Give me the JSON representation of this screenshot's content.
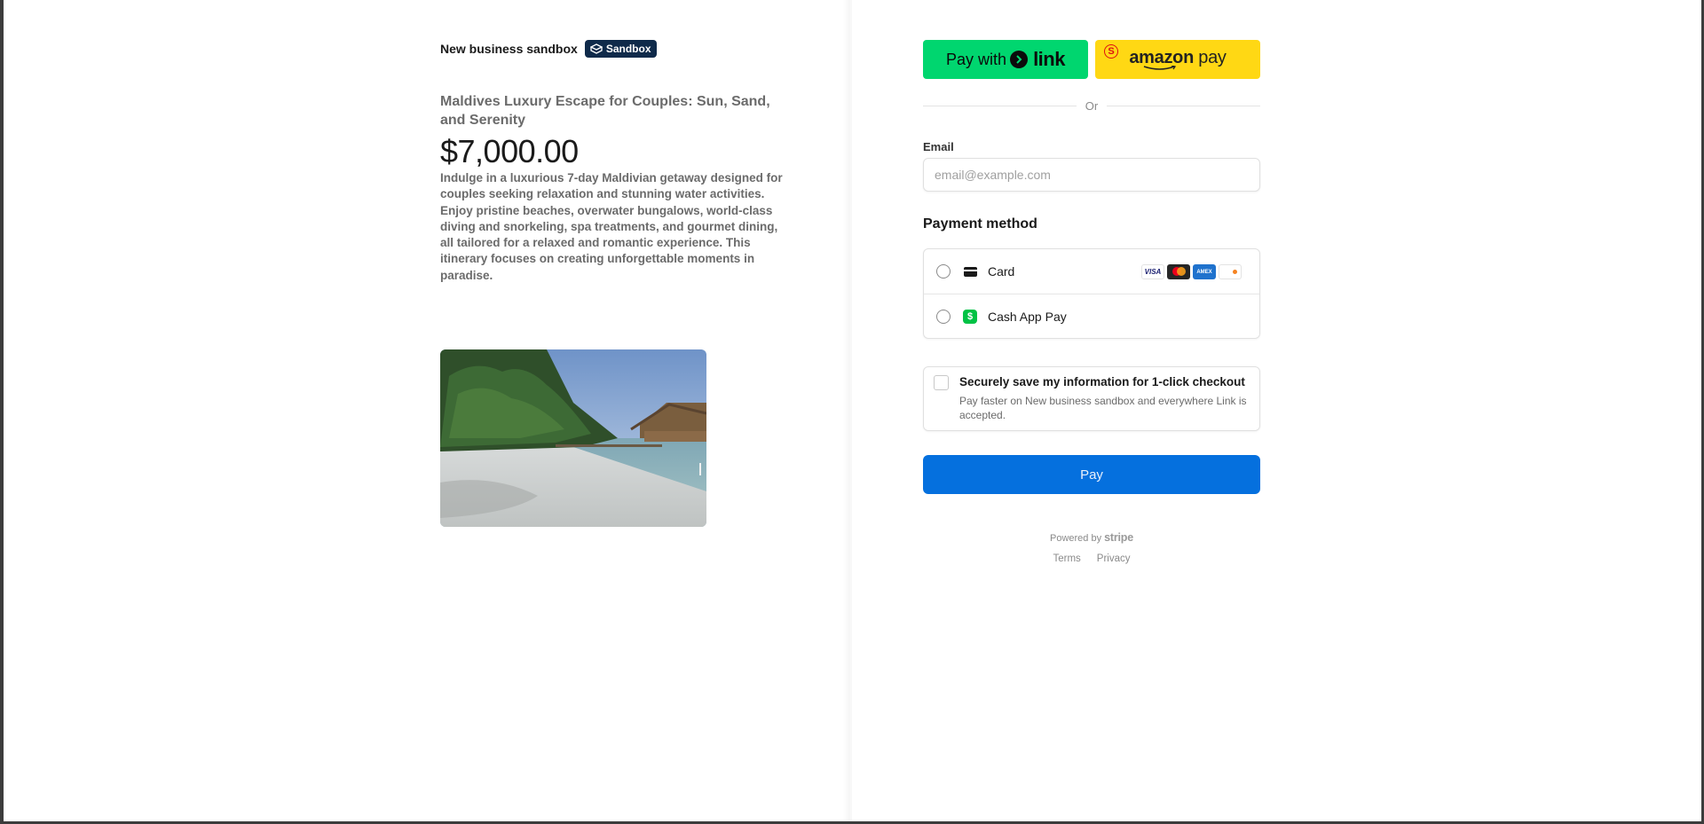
{
  "merchant": {
    "name": "New business sandbox",
    "badge": "Sandbox"
  },
  "product": {
    "title": "Maldives Luxury Escape for Couples: Sun, Sand, and Serenity",
    "price": "$7,000.00",
    "description": "Indulge in a luxurious 7-day Maldivian getaway designed for couples seeking relaxation and stunning water activities. Enjoy pristine beaches, overwater bungalows, world-class diving and snorkeling, spa treatments, and gourmet dining, all tailored for a relaxed and romantic experience. This itinerary focuses on creating unforgettable moments in paradise."
  },
  "wallets": {
    "link": {
      "prefix": "Pay with",
      "word": "link",
      "color": "#00d66f"
    },
    "amazon": {
      "brand": "amazon",
      "pay": "pay",
      "color": "#ffd814"
    }
  },
  "divider": "Or",
  "email": {
    "label": "Email",
    "placeholder": "email@example.com",
    "value": ""
  },
  "payment_method": {
    "title": "Payment method",
    "options": [
      {
        "label": "Card",
        "icon": "card-icon",
        "brands": [
          "VISA",
          "mastercard",
          "AMEX",
          "DISCOVER"
        ]
      },
      {
        "label": "Cash App Pay",
        "icon": "cashapp-icon",
        "glyph": "$"
      }
    ]
  },
  "save_info": {
    "title": "Securely save my information for 1-click checkout",
    "description": "Pay faster on New business sandbox and everywhere Link is accepted."
  },
  "pay_button": {
    "label": "Pay",
    "color": "#0570de"
  },
  "footer": {
    "powered_by": "Powered by",
    "stripe": "stripe",
    "terms": "Terms",
    "privacy": "Privacy"
  }
}
